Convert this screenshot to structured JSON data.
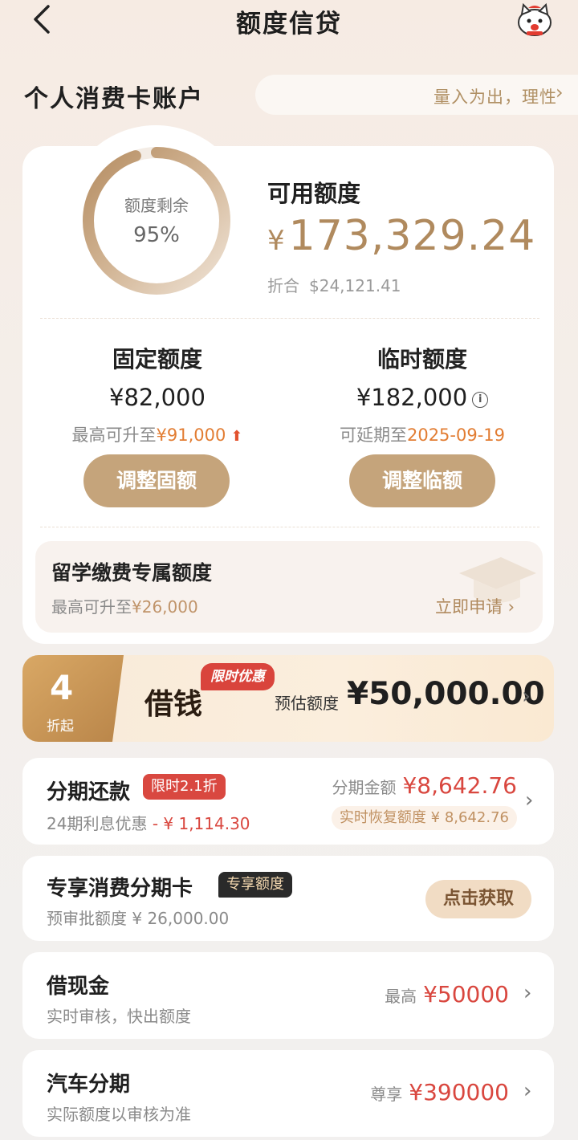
{
  "header": {
    "title": "额度信贷",
    "back_icon": "back-chevron-icon",
    "mascot_icon": "cat-mascot-icon"
  },
  "account": {
    "title": "个人消费卡账户",
    "slogan": "量入为出，理性"
  },
  "summary": {
    "remaining_label": "额度剩余",
    "remaining_percent": "95%",
    "remaining_fraction": 0.95,
    "available_label": "可用额度",
    "available_currency": "¥",
    "available_amount": "173,329.24",
    "approx_label": "折合",
    "approx_amount": "$24,121.41"
  },
  "fixed": {
    "title": "固定额度",
    "amount": "¥82,000",
    "sub_prefix": "最高可升至",
    "sub_value": "¥91,000",
    "button": "调整固额"
  },
  "temporary": {
    "title": "临时额度",
    "amount": "¥182,000",
    "sub_prefix": "可延期至",
    "sub_value": "2025-09-19",
    "button": "调整临额"
  },
  "study": {
    "title": "留学缴费专属额度",
    "sub_prefix": "最高可升至",
    "sub_value": "¥26,000",
    "link": "立即申请 ›"
  },
  "loan": {
    "discount_num": "4",
    "discount_suffix": "折起",
    "name": "借钱",
    "tag": "限时优惠",
    "estimate_label": "预估额度",
    "estimate_amount": "¥50,000.00"
  },
  "installment": {
    "title": "分期还款",
    "tag": "限时2.1折",
    "sub_prefix": "24期利息优惠",
    "sub_value": "- ¥ 1,114.30",
    "amount_label": "分期金额",
    "amount_value": "¥8,642.76",
    "restore_label": "实时恢复额度",
    "restore_value": "¥ 8,642.76"
  },
  "exclusive": {
    "title": "专享消费分期卡",
    "tag": "专享额度",
    "sub": "预审批额度 ¥ 26,000.00",
    "button": "点击获取"
  },
  "cash": {
    "title": "借现金",
    "sub": "实时审核，快出额度",
    "right_label": "最高",
    "right_value": "¥50000"
  },
  "car": {
    "title": "汽车分期",
    "sub": "实际额度以审核为准",
    "right_label": "尊享",
    "right_value": "¥390000"
  },
  "colors": {
    "accent_gold": "#c5a47b",
    "amount_gold": "#b08a5e",
    "highlight_orange": "#e27d33",
    "red": "#d9473f"
  }
}
